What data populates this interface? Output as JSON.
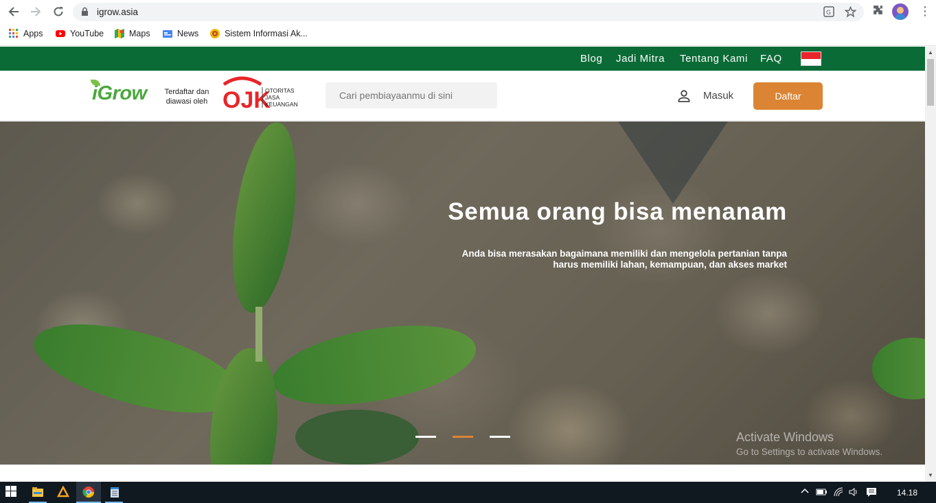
{
  "browser": {
    "url": "igrow.asia",
    "bookmarks": [
      {
        "label": "Apps",
        "icon": "apps-grid-icon"
      },
      {
        "label": "YouTube",
        "icon": "youtube-icon"
      },
      {
        "label": "Maps",
        "icon": "maps-icon"
      },
      {
        "label": "News",
        "icon": "news-icon"
      },
      {
        "label": "Sistem Informasi Ak...",
        "icon": "sia-icon"
      }
    ]
  },
  "topnav": {
    "items": [
      "Blog",
      "Jadi Mitra",
      "Tentang Kami",
      "FAQ"
    ]
  },
  "header": {
    "logo": "iGrow",
    "registered": "Terdaftar dan diawasi oleh",
    "ojk_line1": "OTORITAS",
    "ojk_line2": "JASA",
    "ojk_line3": "KEUANGAN",
    "search_placeholder": "Cari pembiayaanmu di sini",
    "login": "Masuk",
    "register": "Daftar"
  },
  "hero": {
    "title": "Semua orang bisa menanam",
    "subtitle_line1": "Anda bisa merasakan bagaimana memiliki dan mengelola pertanian tanpa",
    "subtitle_line2": "harus memiliki lahan, kemampuan, dan akses market",
    "slides": 3,
    "active_slide": 2
  },
  "watermark": {
    "line1": "Activate Windows",
    "line2": "Go to Settings to activate Windows."
  },
  "taskbar": {
    "clock": "14.18"
  },
  "colors": {
    "brand_green": "#0b6b36",
    "accent_orange": "#db8534"
  }
}
